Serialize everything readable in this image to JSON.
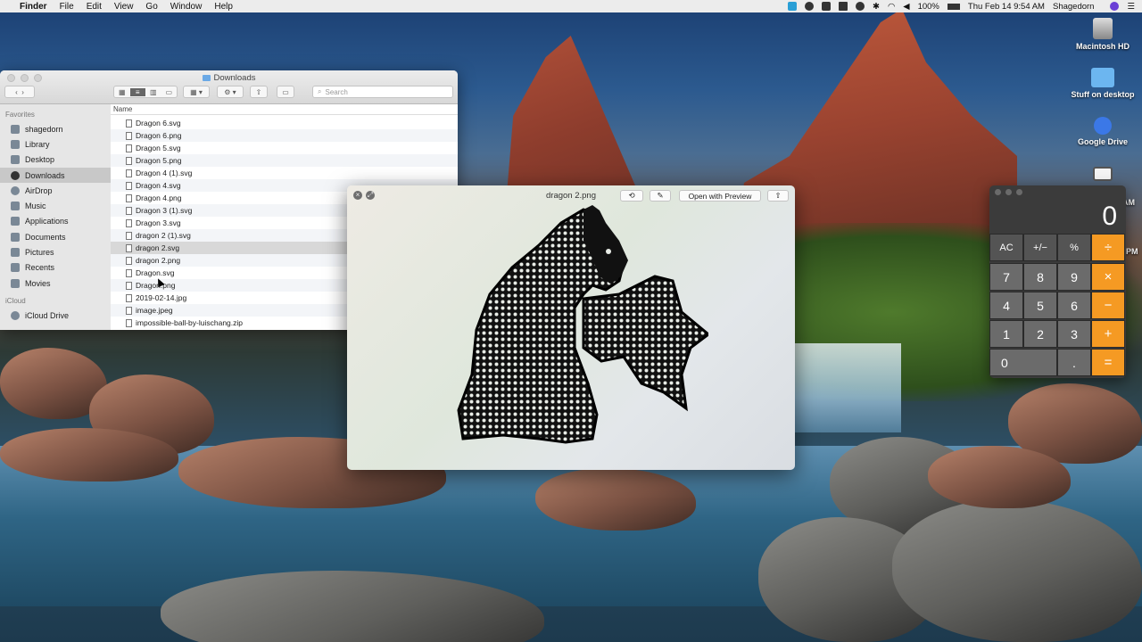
{
  "menubar": {
    "app": "Finder",
    "items": [
      "File",
      "Edit",
      "View",
      "Go",
      "Window",
      "Help"
    ],
    "battery": "100%",
    "datetime": "Thu Feb 14  9:54 AM",
    "user": "Shagedorn"
  },
  "desktop": {
    "icons": [
      "Macintosh HD",
      "Stuff on desktop",
      "Google Drive"
    ],
    "partial_labels": [
      "AM",
      "PM"
    ]
  },
  "finder": {
    "title": "Downloads",
    "search_placeholder": "Search",
    "column_name": "Name",
    "sidebar_heading_favorites": "Favorites",
    "sidebar_heading_icloud": "iCloud",
    "favorites": [
      "shagedorn",
      "Library",
      "Desktop",
      "Downloads",
      "AirDrop",
      "Music",
      "Applications",
      "Documents",
      "Pictures",
      "Recents",
      "Movies"
    ],
    "icloud": [
      "iCloud Drive"
    ],
    "files": [
      "Dragon 6.svg",
      "Dragon 6.png",
      "Dragon 5.svg",
      "Dragon 5.png",
      "Dragon 4 (1).svg",
      "Dragon 4.svg",
      "Dragon 4.png",
      "Dragon 3 (1).svg",
      "Dragon 3.svg",
      "dragon 2 (1).svg",
      "dragon 2.svg",
      "dragon 2.png",
      "Dragon.svg",
      "Dragon.png",
      "2019-02-14.jpg",
      "image.jpeg",
      "impossible-ball-by-luischang.zip"
    ],
    "selected_file": "dragon 2.svg",
    "selected_sidebar": "Downloads"
  },
  "quicklook": {
    "title": "dragon 2.png",
    "open_with": "Open with Preview"
  },
  "calculator": {
    "display": "0",
    "keys": [
      [
        "AC",
        "+/−",
        "%",
        "÷"
      ],
      [
        "7",
        "8",
        "9",
        "×"
      ],
      [
        "4",
        "5",
        "6",
        "−"
      ],
      [
        "1",
        "2",
        "3",
        "+"
      ],
      [
        "0",
        ".",
        "="
      ]
    ],
    "operator_color": "#f59a23"
  }
}
